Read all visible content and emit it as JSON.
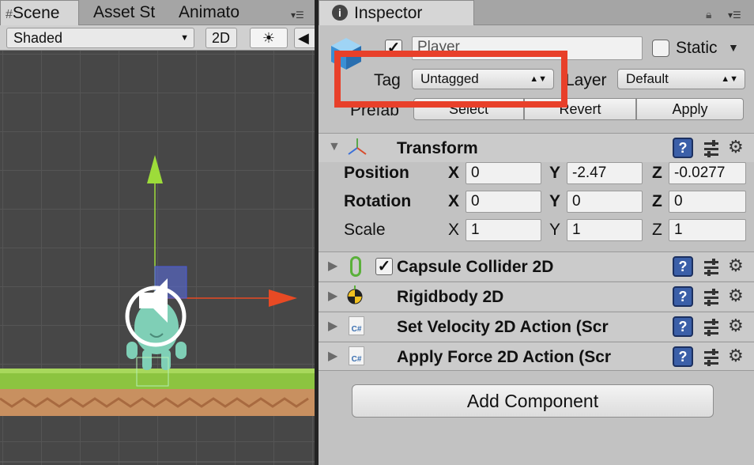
{
  "scene_panel": {
    "tabs": [
      "Scene",
      "Asset St",
      "Animato"
    ],
    "shading_mode": "Shaded",
    "mode_2d_label": "2D"
  },
  "inspector": {
    "tab_label": "Inspector",
    "object_name": "Player",
    "static_label": "Static",
    "tag_label": "Tag",
    "tag_value": "Untagged",
    "layer_label": "Layer",
    "layer_value": "Default",
    "prefab_label": "Prefab",
    "prefab_buttons": [
      "Select",
      "Revert",
      "Apply"
    ],
    "transform": {
      "title": "Transform",
      "rows": [
        {
          "label": "Position",
          "x": "0",
          "y": "-2.47",
          "z": "-0.0277"
        },
        {
          "label": "Rotation",
          "x": "0",
          "y": "0",
          "z": "0"
        },
        {
          "label": "Scale",
          "x": "1",
          "y": "1",
          "z": "1"
        }
      ],
      "axis_labels": [
        "X",
        "Y",
        "Z"
      ]
    },
    "components": [
      {
        "title": "Capsule Collider 2D",
        "icon": "capsule-collider-icon"
      },
      {
        "title": "Rigidbody 2D",
        "icon": "rigidbody-icon"
      },
      {
        "title": "Set Velocity 2D Action (Scr",
        "icon": "csharp-script-icon"
      },
      {
        "title": "Apply Force 2D Action (Scr",
        "icon": "csharp-script-icon"
      }
    ],
    "add_component_label": "Add Component"
  },
  "colors": {
    "highlight_box": "#e8402a",
    "help_icon": "#3b5fa8",
    "gizmo_y": "#9ddc3a",
    "gizmo_x": "#e84a24",
    "ground_grass": "#8cc440",
    "ground_dirt": "#c89060"
  }
}
